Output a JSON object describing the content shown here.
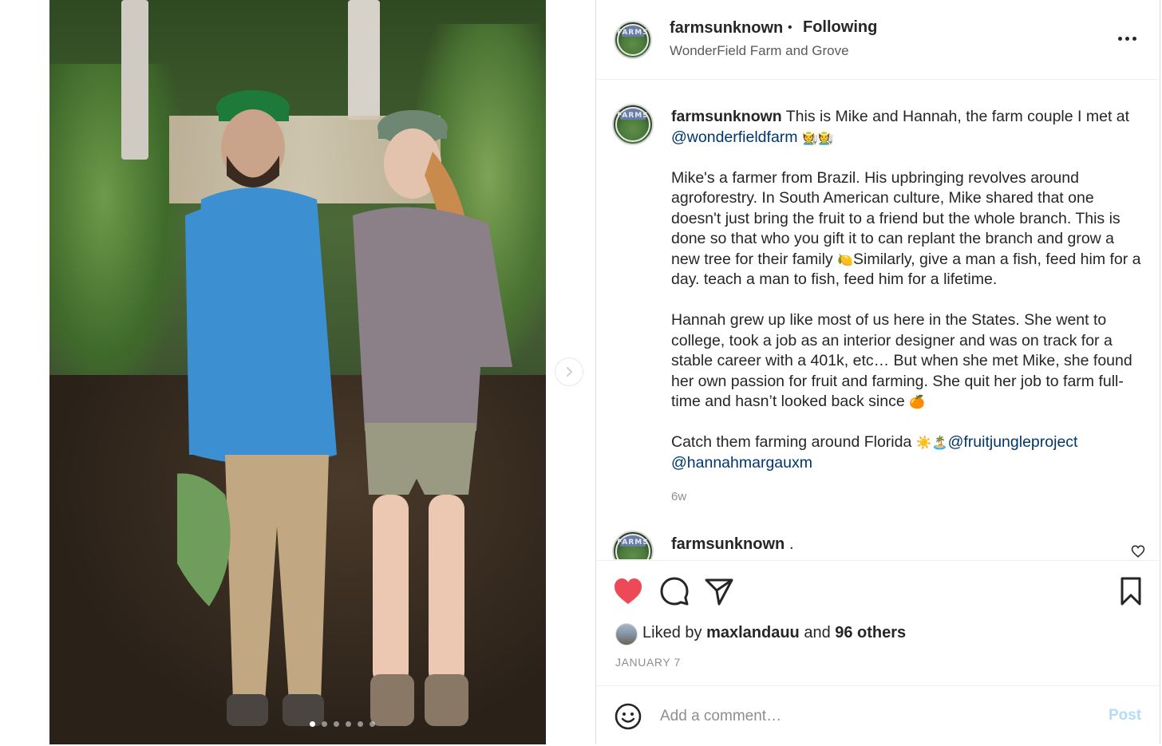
{
  "post": {
    "username": "farmsunknown",
    "separator": "•",
    "follow_status": "Following",
    "location": "WonderField Farm and Grove",
    "avatar_text": "FARMS"
  },
  "media": {
    "image_description_icon": "photo-of-farm-couple",
    "slide_count": 6,
    "active_slide": 1
  },
  "caption": {
    "username": "farmsunknown",
    "line1_text": " This is Mike and Hannah, the farm couple I met at ",
    "mention1": "@wonderfieldfarm",
    "line1_emoji": "🧑‍🌾🧑‍🌾",
    "p2": "Mike's a farmer from Brazil. His upbringing revolves around agroforestry. In South American culture, Mike shared that one doesn't just bring the fruit to a friend but the whole branch. This is done so that who you gift it to can replant the branch and grow a new tree for their family ",
    "p2_emoji": "🍋",
    "p2_end": "Similarly, give a man a fish, feed him for a day. teach a man to fish, feed him for a lifetime.",
    "p3": "Hannah grew up like most of us here in the States. She went to college, took a job as an interior designer and was on track for a stable career with a 401k, etc… But when she met Mike, she found her own passion for fruit and farming. She quit her job to farm full-time and hasn’t looked back since ",
    "p3_emoji": "🍊",
    "p4": "Catch them farming around Florida ",
    "p4_emoji": "☀️🏝️",
    "mention2": "@fruitjungleproject",
    "mention3": "@hannahmargauxm",
    "time": "6w"
  },
  "reply": {
    "username": "farmsunknown",
    "text": "."
  },
  "engagement": {
    "liked_prefix": "Liked by ",
    "liked_user": "maxlandauu",
    "liked_mid": " and ",
    "liked_others": "96 others",
    "date": "JANUARY 7",
    "heart_color": "#ed4956"
  },
  "comment_box": {
    "placeholder": "Add a comment…",
    "post_label": "Post",
    "post_color": "#b3dbff"
  }
}
